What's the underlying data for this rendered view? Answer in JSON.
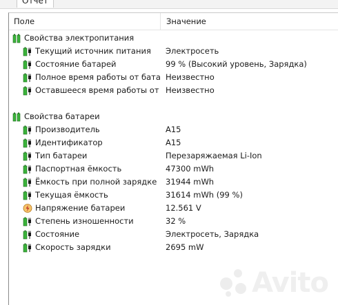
{
  "window": {
    "tab_title": "Отчет"
  },
  "columns": {
    "field": "Поле",
    "value": "Значение"
  },
  "groups": [
    {
      "label": "Свойства электропитания",
      "icon": "battery-group-icon",
      "rows": [
        {
          "field": "Текущий источник питания",
          "value": "Электросеть",
          "icon": "battery-plug-icon"
        },
        {
          "field": "Состояние батарей",
          "value": "99 % (Высокий уровень, Зарядка)",
          "icon": "battery-plug-icon"
        },
        {
          "field": "Полное время работы от батар...",
          "value": "Неизвестно",
          "icon": "battery-plug-icon"
        },
        {
          "field": "Оставшееся время работы от ...",
          "value": "Неизвестно",
          "icon": "battery-plug-icon"
        }
      ]
    },
    {
      "label": "Свойства батареи",
      "icon": "battery-group-icon",
      "rows": [
        {
          "field": "Производитель",
          "value": "A15",
          "icon": "battery-plug-icon"
        },
        {
          "field": "Идентификатор",
          "value": "A15",
          "icon": "battery-plug-icon"
        },
        {
          "field": "Тип батареи",
          "value": "Перезаряжаемая Li-Ion",
          "icon": "battery-plug-icon"
        },
        {
          "field": "Паспортная ёмкость",
          "value": "47300 mWh",
          "icon": "battery-plug-icon"
        },
        {
          "field": "Ёмкость при полной зарядке",
          "value": "31944 mWh",
          "icon": "battery-plug-icon"
        },
        {
          "field": "Текущая ёмкость",
          "value": "31614 mWh  (99 %)",
          "icon": "battery-plug-icon"
        },
        {
          "field": "Напряжение батареи",
          "value": "12.561 V",
          "icon": "voltage-icon"
        },
        {
          "field": "Степень изношенности",
          "value": "32 %",
          "icon": "battery-plug-icon"
        },
        {
          "field": "Состояние",
          "value": "Электросеть, Зарядка",
          "icon": "battery-plug-icon"
        },
        {
          "field": "Скорость зарядки",
          "value": "2695 mW",
          "icon": "battery-plug-icon"
        }
      ]
    }
  ],
  "watermark": {
    "text": "Avito"
  },
  "colors": {
    "battery_green": "#3bb33b",
    "battery_dark": "#1a1a1a",
    "voltage_orange": "#e8a33c",
    "voltage_bolt": "#c0392b"
  }
}
